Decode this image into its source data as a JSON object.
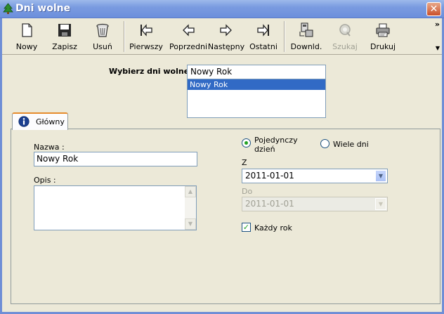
{
  "window": {
    "title": "Dni wolne"
  },
  "toolbar": {
    "buttons": [
      {
        "label": "Nowy",
        "icon": "new-document-icon"
      },
      {
        "label": "Zapisz",
        "icon": "floppy-disk-icon"
      },
      {
        "label": "Usuń",
        "icon": "trash-icon"
      },
      {
        "label": "Pierwszy",
        "icon": "first-record-icon"
      },
      {
        "label": "Poprzedni",
        "icon": "arrow-left-icon"
      },
      {
        "label": "Następny",
        "icon": "arrow-right-icon"
      },
      {
        "label": "Ostatni",
        "icon": "last-record-icon"
      },
      {
        "label": "Downld.",
        "icon": "download-icon"
      },
      {
        "label": "Szukaj",
        "icon": "search-icon"
      },
      {
        "label": "Drukuj",
        "icon": "printer-icon"
      }
    ],
    "overflow": "»"
  },
  "selector": {
    "label": "Wybierz dni wolne:",
    "value": "Nowy Rok",
    "items": [
      "Nowy Rok"
    ]
  },
  "tab": {
    "label": "Główny"
  },
  "form": {
    "nazwa_label": "Nazwa :",
    "nazwa_value": "Nowy Rok",
    "opis_label": "Opis :",
    "radio_single_line1": "Pojedynczy",
    "radio_single_line2": "dzień",
    "radio_multi": "Wiele dni",
    "z_label": "Z",
    "z_value": "2011-01-01",
    "do_label": "Do",
    "do_value": "2011-01-01",
    "kazdy_rok_label": "Każdy rok"
  }
}
